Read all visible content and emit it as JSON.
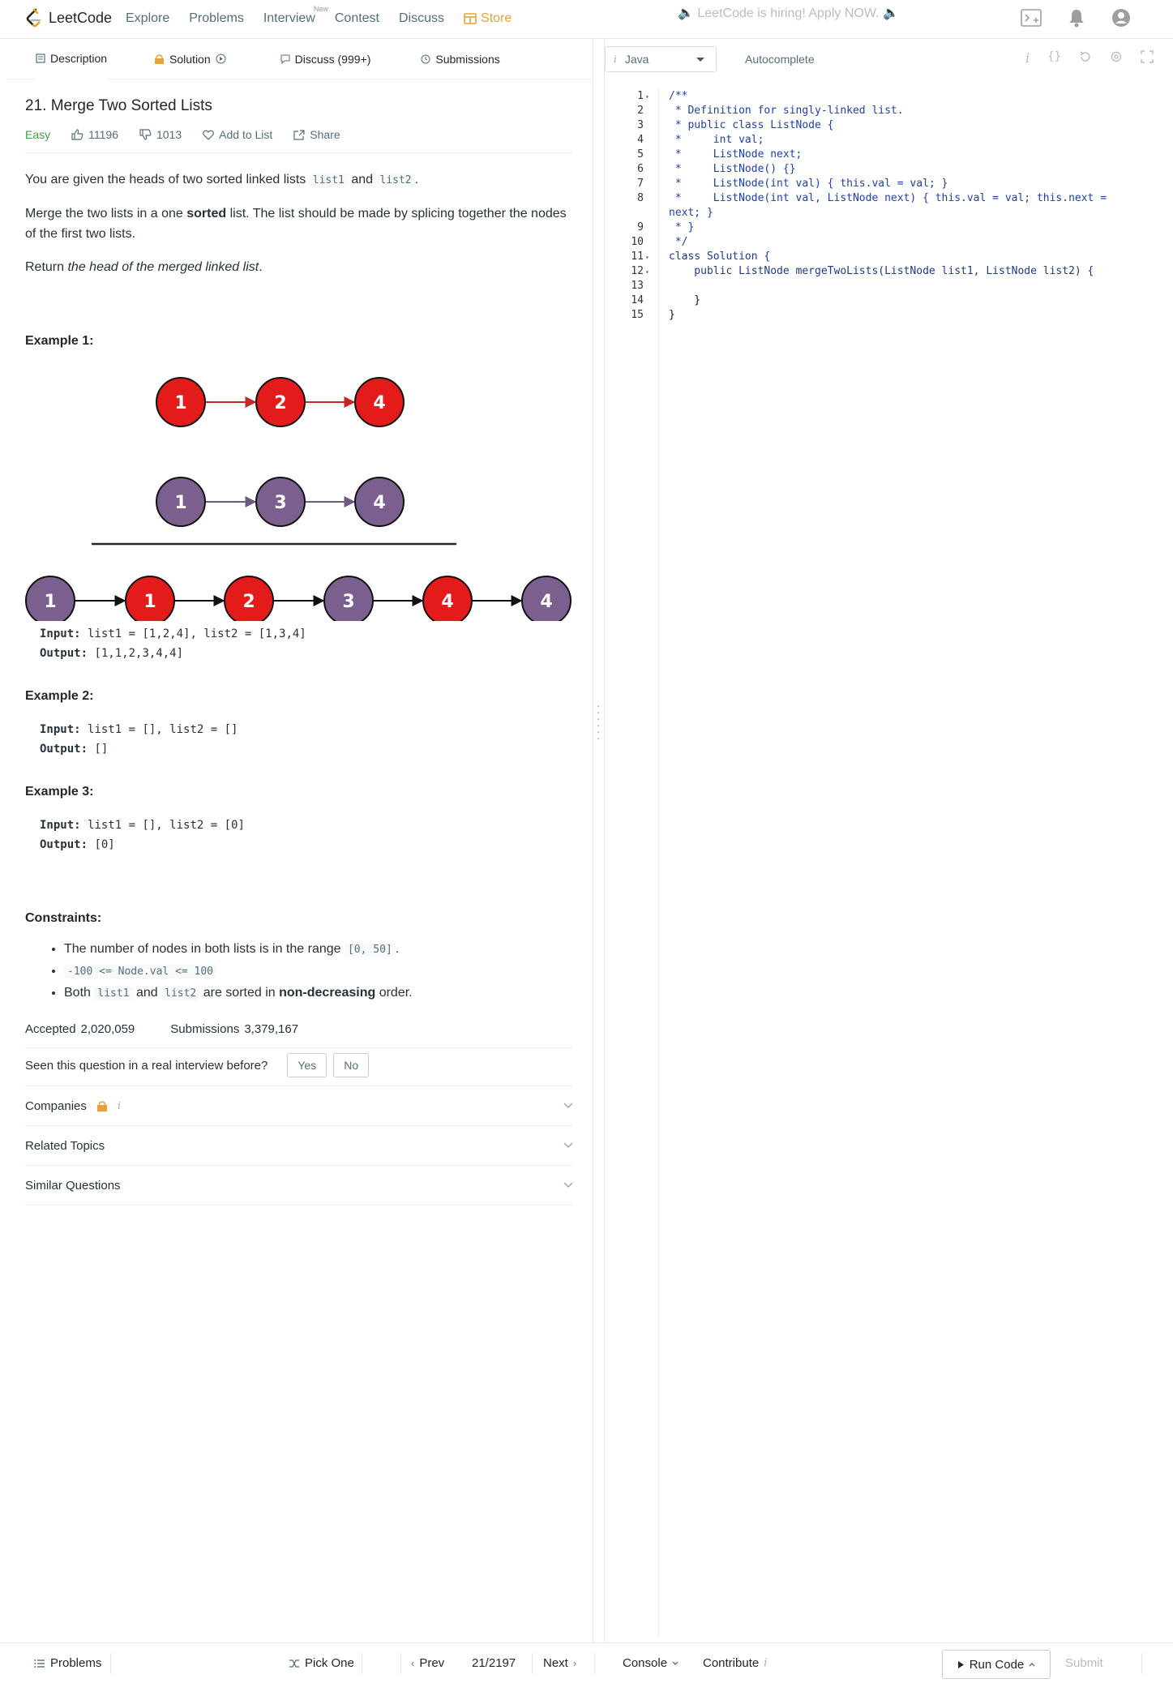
{
  "nav": {
    "logo": "LeetCode",
    "links": [
      "Explore",
      "Problems",
      "Interview",
      "Contest",
      "Discuss"
    ],
    "new_badge": "New",
    "store": "Store",
    "hiring": "LeetCode is hiring! Apply NOW."
  },
  "tabs": {
    "description": "Description",
    "solution": "Solution",
    "discuss": "Discuss (999+)",
    "submissions": "Submissions"
  },
  "problem": {
    "title": "21. Merge Two Sorted Lists",
    "difficulty": "Easy",
    "likes": "11196",
    "dislikes": "1013",
    "add_to_list": "Add to List",
    "share": "Share",
    "p1_a": "You are given the heads of two sorted linked lists",
    "p1_code1": "list1",
    "p1_and": "and",
    "p1_code2": "list2",
    "p1_end": ".",
    "p2_a": "Merge the two lists in a one",
    "p2_bold": "sorted",
    "p2_b": "list. The list should be made by splicing together the nodes of the first two lists.",
    "p3_a": "Return",
    "p3_em": "the head of the merged linked list",
    "p3_end": "."
  },
  "example1": {
    "title": "Example 1:",
    "list1": [
      "1",
      "2",
      "4"
    ],
    "list2": [
      "1",
      "3",
      "4"
    ],
    "merged": [
      "1",
      "1",
      "2",
      "3",
      "4",
      "4"
    ],
    "merged_colors": [
      "purple",
      "red",
      "red",
      "purple",
      "red",
      "purple"
    ],
    "input_label": "Input:",
    "input": "list1 = [1,2,4], list2 = [1,3,4]",
    "output_label": "Output:",
    "output": "[1,1,2,3,4,4]"
  },
  "example2": {
    "title": "Example 2:",
    "input_label": "Input:",
    "input": "list1 = [], list2 = []",
    "output_label": "Output:",
    "output": "[]"
  },
  "example3": {
    "title": "Example 3:",
    "input_label": "Input:",
    "input": "list1 = [], list2 = [0]",
    "output_label": "Output:",
    "output": "[0]"
  },
  "constraints": {
    "title": "Constraints:",
    "c1_a": "The number of nodes in both lists is in the range",
    "c1_code": "[0, 50]",
    "c1_end": ".",
    "c2_code": "-100 <= Node.val <= 100",
    "c3_a": "Both",
    "c3_code1": "list1",
    "c3_and": "and",
    "c3_code2": "list2",
    "c3_b": "are sorted in",
    "c3_bold": "non-decreasing",
    "c3_end": "order."
  },
  "stats": {
    "accepted_label": "Accepted",
    "accepted": "2,020,059",
    "submissions_label": "Submissions",
    "submissions": "3,379,167"
  },
  "interview": {
    "question": "Seen this question in a real interview before?",
    "yes": "Yes",
    "no": "No"
  },
  "sections": {
    "companies": "Companies",
    "related": "Related Topics",
    "similar": "Similar Questions"
  },
  "editor": {
    "language": "Java",
    "autocomplete": "Autocomplete",
    "lines": [
      {
        "n": "1",
        "fold": true,
        "text": "/**",
        "cls": "cm"
      },
      {
        "n": "2",
        "fold": false,
        "text": " * Definition for singly-linked list.",
        "cls": "cm"
      },
      {
        "n": "3",
        "fold": false,
        "text": " * public class ListNode {",
        "cls": "cm"
      },
      {
        "n": "4",
        "fold": false,
        "text": " *     int val;",
        "cls": "cm"
      },
      {
        "n": "5",
        "fold": false,
        "text": " *     ListNode next;",
        "cls": "cm"
      },
      {
        "n": "6",
        "fold": false,
        "text": " *     ListNode() {}",
        "cls": "cm"
      },
      {
        "n": "7",
        "fold": false,
        "text": " *     ListNode(int val) { this.val = val; }",
        "cls": "cm"
      },
      {
        "n": "8",
        "fold": false,
        "text": " *     ListNode(int val, ListNode next) { this.val = val; this.next =",
        "cls": "cm"
      },
      {
        "n": "",
        "fold": false,
        "text": "next; }",
        "cls": "cm"
      },
      {
        "n": "9",
        "fold": false,
        "text": " * }",
        "cls": "cm"
      },
      {
        "n": "10",
        "fold": false,
        "text": " */",
        "cls": "cm"
      },
      {
        "n": "11",
        "fold": true,
        "text": "class Solution {",
        "cls": "kw"
      },
      {
        "n": "12",
        "fold": true,
        "text": "    public ListNode mergeTwoLists(ListNode list1, ListNode list2) {",
        "cls": "kw"
      },
      {
        "n": "13",
        "fold": false,
        "text": "",
        "cls": "tx"
      },
      {
        "n": "14",
        "fold": false,
        "text": "    }",
        "cls": "tx"
      },
      {
        "n": "15",
        "fold": false,
        "text": "}",
        "cls": "tx"
      }
    ]
  },
  "bottom": {
    "problems": "Problems",
    "pick_one": "Pick One",
    "prev": "Prev",
    "counter": "21/2197",
    "next": "Next",
    "console": "Console",
    "contribute": "Contribute",
    "run_code": "Run Code",
    "submit": "Submit"
  },
  "colors": {
    "red_node": "#e31b1b",
    "purple_node": "#7a5f8f",
    "red_arrow": "#c62828",
    "purple_arrow": "#6c5a82",
    "easy": "#43a047",
    "store": "#e6a23c"
  }
}
